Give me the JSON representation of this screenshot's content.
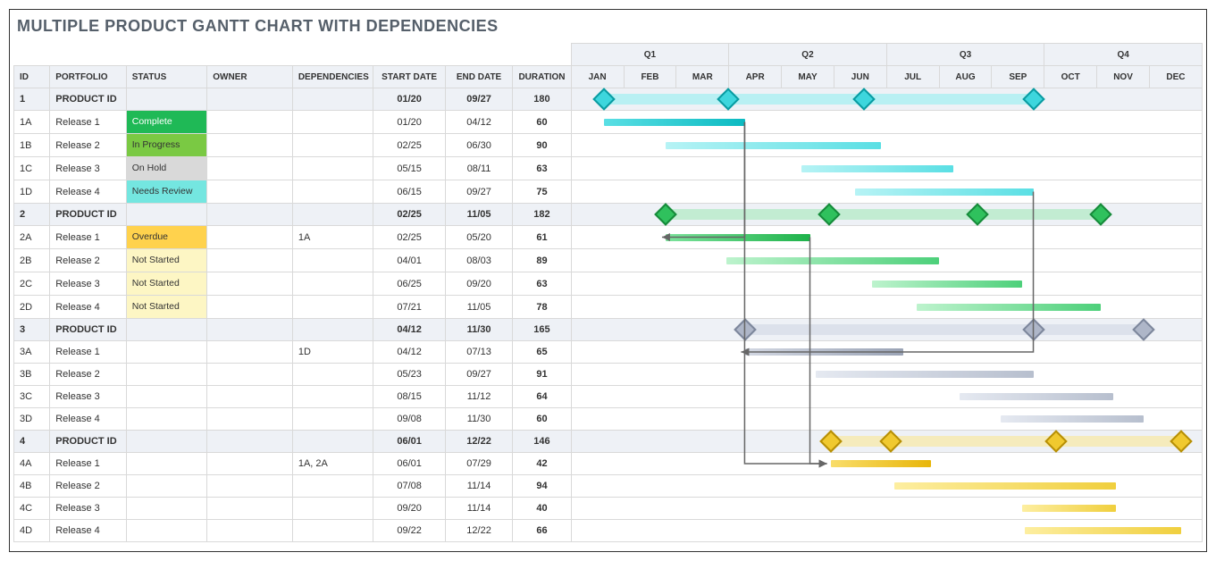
{
  "title": "MULTIPLE PRODUCT GANTT CHART WITH DEPENDENCIES",
  "columns": {
    "id": "ID",
    "portfolio": "PORTFOLIO",
    "status": "STATUS",
    "owner": "OWNER",
    "dependencies": "DEPENDENCIES",
    "start_date": "START DATE",
    "end_date": "END DATE",
    "duration": "DURATION"
  },
  "quarters": [
    "Q1",
    "Q2",
    "Q3",
    "Q4"
  ],
  "months": [
    "JAN",
    "FEB",
    "MAR",
    "APR",
    "MAY",
    "JUN",
    "JUL",
    "AUG",
    "SEP",
    "OCT",
    "NOV",
    "DEC"
  ],
  "status_styles": {
    "Complete": "s-complete",
    "In Progress": "s-inprogress",
    "On Hold": "s-onhold",
    "Needs Review": "s-needsreview",
    "Overdue": "s-overdue",
    "Not Started": "s-notstarted"
  },
  "rows": [
    {
      "rid": "1",
      "portfolio": "PRODUCT ID",
      "status": "",
      "owner": "",
      "dep": "",
      "start": "01/20",
      "end": "09/27",
      "dur": "180",
      "type": "summary",
      "theme": "teal",
      "diamonds": [
        92,
        171,
        270
      ]
    },
    {
      "rid": "1A",
      "portfolio": "Release 1",
      "status": "Complete",
      "owner": "",
      "dep": "",
      "start": "01/20",
      "end": "04/12",
      "dur": "60",
      "type": "task",
      "theme": "teal"
    },
    {
      "rid": "1B",
      "portfolio": "Release 2",
      "status": "In Progress",
      "owner": "",
      "dep": "",
      "start": "02/25",
      "end": "06/30",
      "dur": "90",
      "type": "task",
      "theme": "tealL"
    },
    {
      "rid": "1C",
      "portfolio": "Release 3",
      "status": "On Hold",
      "owner": "",
      "dep": "",
      "start": "05/15",
      "end": "08/11",
      "dur": "63",
      "type": "task",
      "theme": "tealL"
    },
    {
      "rid": "1D",
      "portfolio": "Release 4",
      "status": "Needs Review",
      "owner": "",
      "dep": "",
      "start": "06/15",
      "end": "09/27",
      "dur": "75",
      "type": "task",
      "theme": "tealL"
    },
    {
      "rid": "2",
      "portfolio": "PRODUCT ID",
      "status": "",
      "owner": "",
      "dep": "",
      "start": "02/25",
      "end": "11/05",
      "dur": "182",
      "type": "summary",
      "theme": "green",
      "diamonds": [
        56,
        151,
        237,
        309
      ]
    },
    {
      "rid": "2A",
      "portfolio": "Release 1",
      "status": "Overdue",
      "owner": "",
      "dep": "1A",
      "start": "02/25",
      "end": "05/20",
      "dur": "61",
      "type": "task",
      "theme": "green"
    },
    {
      "rid": "2B",
      "portfolio": "Release 2",
      "status": "Not Started",
      "owner": "",
      "dep": "",
      "start": "04/01",
      "end": "08/03",
      "dur": "89",
      "type": "task",
      "theme": "greenL"
    },
    {
      "rid": "2C",
      "portfolio": "Release 3",
      "status": "Not Started",
      "owner": "",
      "dep": "",
      "start": "06/25",
      "end": "09/20",
      "dur": "63",
      "type": "task",
      "theme": "greenL"
    },
    {
      "rid": "2D",
      "portfolio": "Release 4",
      "status": "Not Started",
      "owner": "",
      "dep": "",
      "start": "07/21",
      "end": "11/05",
      "dur": "78",
      "type": "task",
      "theme": "greenL"
    },
    {
      "rid": "3",
      "portfolio": "PRODUCT ID",
      "status": "",
      "owner": "",
      "dep": "",
      "start": "04/12",
      "end": "11/30",
      "dur": "165",
      "type": "summary",
      "theme": "slate",
      "diamonds": [
        102,
        270,
        334
      ]
    },
    {
      "rid": "3A",
      "portfolio": "Release 1",
      "status": "",
      "owner": "",
      "dep": "1D",
      "start": "04/12",
      "end": "07/13",
      "dur": "65",
      "type": "task",
      "theme": "slate"
    },
    {
      "rid": "3B",
      "portfolio": "Release 2",
      "status": "",
      "owner": "",
      "dep": "",
      "start": "05/23",
      "end": "09/27",
      "dur": "91",
      "type": "task",
      "theme": "slateL"
    },
    {
      "rid": "3C",
      "portfolio": "Release 3",
      "status": "",
      "owner": "",
      "dep": "",
      "start": "08/15",
      "end": "11/12",
      "dur": "64",
      "type": "task",
      "theme": "slateL"
    },
    {
      "rid": "3D",
      "portfolio": "Release 4",
      "status": "",
      "owner": "",
      "dep": "",
      "start": "09/08",
      "end": "11/30",
      "dur": "60",
      "type": "task",
      "theme": "slateL"
    },
    {
      "rid": "4",
      "portfolio": "PRODUCT ID",
      "status": "",
      "owner": "",
      "dep": "",
      "start": "06/01",
      "end": "12/22",
      "dur": "146",
      "type": "summary",
      "theme": "gold",
      "diamonds": [
        152,
        187,
        283,
        356
      ]
    },
    {
      "rid": "4A",
      "portfolio": "Release 1",
      "status": "",
      "owner": "",
      "dep": "1A, 2A",
      "start": "06/01",
      "end": "07/29",
      "dur": "42",
      "type": "task",
      "theme": "gold"
    },
    {
      "rid": "4B",
      "portfolio": "Release 2",
      "status": "",
      "owner": "",
      "dep": "",
      "start": "07/08",
      "end": "11/14",
      "dur": "94",
      "type": "task",
      "theme": "goldL"
    },
    {
      "rid": "4C",
      "portfolio": "Release 3",
      "status": "",
      "owner": "",
      "dep": "",
      "start": "09/20",
      "end": "11/14",
      "dur": "40",
      "type": "task",
      "theme": "goldL"
    },
    {
      "rid": "4D",
      "portfolio": "Release 4",
      "status": "",
      "owner": "",
      "dep": "",
      "start": "09/22",
      "end": "12/22",
      "dur": "66",
      "type": "task",
      "theme": "goldL"
    }
  ],
  "dependencies_arrows": [
    {
      "from": "1A",
      "to": "2A"
    },
    {
      "from": "1D",
      "to": "3A"
    },
    {
      "from": "2A",
      "to": "4A"
    },
    {
      "from": "1A",
      "to": "4A"
    }
  ],
  "chart_data": {
    "type": "gantt",
    "title": "Multiple Product Gantt Chart with Dependencies",
    "time_axis": {
      "unit": "day",
      "range_days": [
        1,
        365
      ],
      "quarter_labels": [
        "Q1",
        "Q2",
        "Q3",
        "Q4"
      ],
      "month_labels": [
        "JAN",
        "FEB",
        "MAR",
        "APR",
        "MAY",
        "JUN",
        "JUL",
        "AUG",
        "SEP",
        "OCT",
        "NOV",
        "DEC"
      ]
    },
    "products": [
      {
        "id": "1",
        "name": "PRODUCT ID",
        "start": "01/20",
        "end": "09/27",
        "duration": 180,
        "milestones_day_of_year": [
          92,
          171,
          270
        ],
        "color": "teal",
        "tasks": [
          {
            "id": "1A",
            "name": "Release 1",
            "status": "Complete",
            "start": "01/20",
            "end": "04/12",
            "duration": 60
          },
          {
            "id": "1B",
            "name": "Release 2",
            "status": "In Progress",
            "start": "02/25",
            "end": "06/30",
            "duration": 90
          },
          {
            "id": "1C",
            "name": "Release 3",
            "status": "On Hold",
            "start": "05/15",
            "end": "08/11",
            "duration": 63
          },
          {
            "id": "1D",
            "name": "Release 4",
            "status": "Needs Review",
            "start": "06/15",
            "end": "09/27",
            "duration": 75
          }
        ]
      },
      {
        "id": "2",
        "name": "PRODUCT ID",
        "start": "02/25",
        "end": "11/05",
        "duration": 182,
        "milestones_day_of_year": [
          56,
          151,
          237,
          309
        ],
        "color": "green",
        "tasks": [
          {
            "id": "2A",
            "name": "Release 1",
            "status": "Overdue",
            "dependencies": [
              "1A"
            ],
            "start": "02/25",
            "end": "05/20",
            "duration": 61
          },
          {
            "id": "2B",
            "name": "Release 2",
            "status": "Not Started",
            "start": "04/01",
            "end": "08/03",
            "duration": 89
          },
          {
            "id": "2C",
            "name": "Release 3",
            "status": "Not Started",
            "start": "06/25",
            "end": "09/20",
            "duration": 63
          },
          {
            "id": "2D",
            "name": "Release 4",
            "status": "Not Started",
            "start": "07/21",
            "end": "11/05",
            "duration": 78
          }
        ]
      },
      {
        "id": "3",
        "name": "PRODUCT ID",
        "start": "04/12",
        "end": "11/30",
        "duration": 165,
        "milestones_day_of_year": [
          102,
          270,
          334
        ],
        "color": "slate",
        "tasks": [
          {
            "id": "3A",
            "name": "Release 1",
            "dependencies": [
              "1D"
            ],
            "start": "04/12",
            "end": "07/13",
            "duration": 65
          },
          {
            "id": "3B",
            "name": "Release 2",
            "start": "05/23",
            "end": "09/27",
            "duration": 91
          },
          {
            "id": "3C",
            "name": "Release 3",
            "start": "08/15",
            "end": "11/12",
            "duration": 64
          },
          {
            "id": "3D",
            "name": "Release 4",
            "start": "09/08",
            "end": "11/30",
            "duration": 60
          }
        ]
      },
      {
        "id": "4",
        "name": "PRODUCT ID",
        "start": "06/01",
        "end": "12/22",
        "duration": 146,
        "milestones_day_of_year": [
          152,
          187,
          283,
          356
        ],
        "color": "gold",
        "tasks": [
          {
            "id": "4A",
            "name": "Release 1",
            "dependencies": [
              "1A",
              "2A"
            ],
            "start": "06/01",
            "end": "07/29",
            "duration": 42
          },
          {
            "id": "4B",
            "name": "Release 2",
            "start": "07/08",
            "end": "11/14",
            "duration": 94
          },
          {
            "id": "4C",
            "name": "Release 3",
            "start": "09/20",
            "end": "11/14",
            "duration": 40
          },
          {
            "id": "4D",
            "name": "Release 4",
            "start": "09/22",
            "end": "12/22",
            "duration": 66
          }
        ]
      }
    ],
    "dependencies": [
      [
        "1A",
        "2A"
      ],
      [
        "1D",
        "3A"
      ],
      [
        "1A",
        "4A"
      ],
      [
        "2A",
        "4A"
      ]
    ]
  }
}
